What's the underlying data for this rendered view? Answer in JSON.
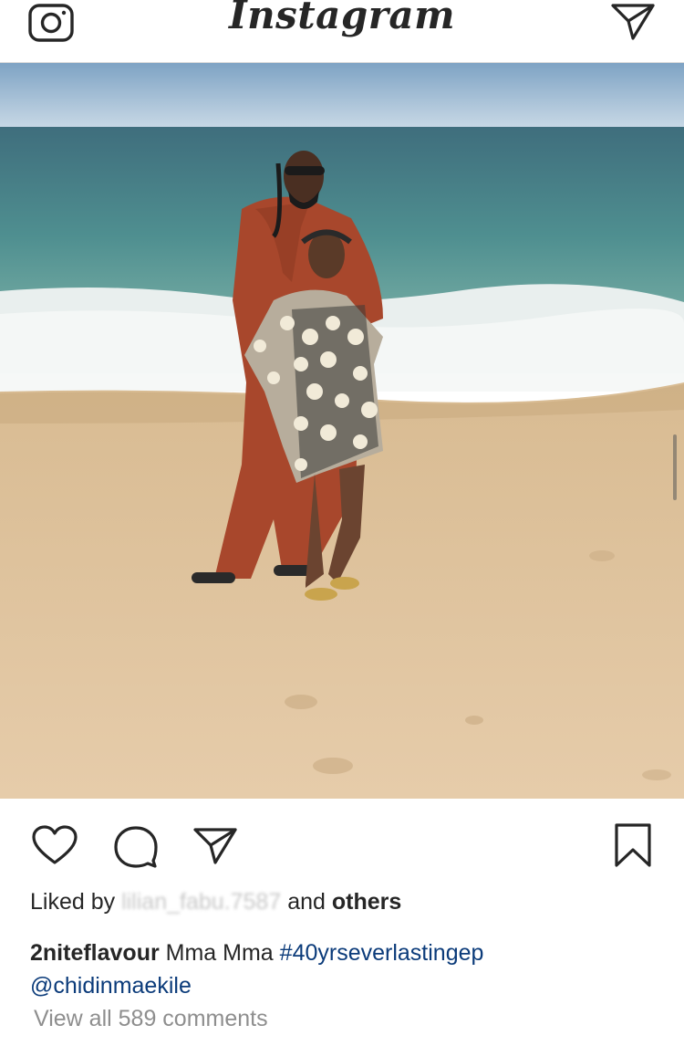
{
  "header": {
    "logo": "Instagram",
    "camera_icon": "camera-icon",
    "direct_icon": "paper-plane-icon"
  },
  "post": {
    "image_alt": "Couple standing on a sandy beach by the sea",
    "actions": {
      "like_icon": "heart-icon",
      "comment_icon": "speech-bubble-icon",
      "share_icon": "paper-plane-icon",
      "save_icon": "bookmark-icon"
    },
    "likes": {
      "prefix": "Liked by",
      "liker": "lilian_fabu.7587",
      "conjunction": "and",
      "others": "others"
    },
    "caption": {
      "username": "2niteflavour",
      "text": "Mma Mma",
      "hashtag": "#40yrseverlastingep",
      "mention": "@chidinmaekile"
    },
    "view_comments": "View all 589 comments"
  },
  "colors": {
    "text": "#262626",
    "link": "#0b3b7a",
    "muted": "#8e8e8e",
    "divider": "#dbdbdb"
  }
}
